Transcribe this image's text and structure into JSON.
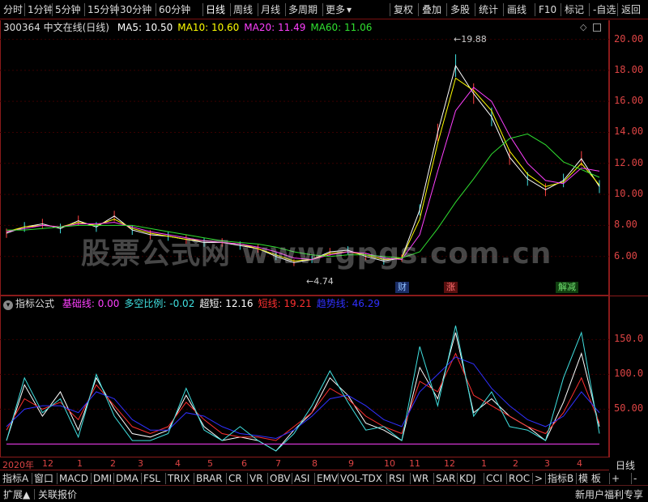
{
  "toolbar": {
    "periods": [
      "分时",
      "1分钟",
      "5分钟",
      "15分钟",
      "30分钟",
      "60分钟",
      "日线",
      "周线",
      "月线",
      "多周期",
      "更多"
    ],
    "active_period": "日线",
    "more_caret": "▾",
    "actions": [
      "复权",
      "叠加",
      "多股",
      "统计",
      "画线",
      "F10",
      "标记",
      "-自选",
      "返回"
    ]
  },
  "header": {
    "stock": "300364 中文在线(日线)",
    "ma": [
      {
        "label": "MA5: 10.50",
        "color": "#ffffff"
      },
      {
        "label": "MA10: 10.60",
        "color": "#ffff00"
      },
      {
        "label": "MA20: 11.49",
        "color": "#ff40ff"
      },
      {
        "label": "MA60: 11.06",
        "color": "#30e030"
      }
    ]
  },
  "price_axis": [
    "20.00",
    "18.00",
    "16.00",
    "14.00",
    "12.00",
    "10.00",
    "8.00",
    "6.00"
  ],
  "annotations": {
    "high": "19.88",
    "low": "4.74"
  },
  "event_tags": [
    {
      "label": "财",
      "color": "#6ab0ff"
    },
    {
      "label": "涨",
      "color": "#ff5050"
    },
    {
      "label": "解减",
      "color": "#40d040"
    }
  ],
  "watermark": "股票公式网 www.gpgs.com.cn",
  "indicator": {
    "title": "指标公式",
    "lines": [
      {
        "label": "基础线: 0.00",
        "color": "#ff40ff"
      },
      {
        "label": "多空比例: -0.02",
        "color": "#40e0e0"
      },
      {
        "label": "超短: 12.16",
        "color": "#ffffff"
      },
      {
        "label": "短线: 19.21",
        "color": "#ff3030"
      },
      {
        "label": "趋势线: 46.29",
        "color": "#3030ff"
      }
    ],
    "axis": [
      "150.0",
      "100.0",
      "50.00"
    ]
  },
  "time_axis": {
    "year": "2020年",
    "months": [
      "12",
      "1",
      "2",
      "3",
      "4",
      "5",
      "6",
      "7",
      "8",
      "9",
      "10",
      "11",
      "12",
      "1",
      "2",
      "3",
      "4"
    ],
    "period_label": "日线"
  },
  "tabs": [
    "指标A",
    "窗口",
    "MACD",
    "DMI",
    "DMA",
    "FSL",
    "TRIX",
    "BRAR",
    "CR",
    "VR",
    "OBV",
    "ASI",
    "EMV",
    "VOL-TDX",
    "RSI",
    "WR",
    "SAR",
    "KDJ",
    "CCI",
    "ROC",
    ">",
    "指标B",
    "模 板",
    "+",
    "-"
  ],
  "footer": {
    "left": [
      "扩展▲",
      "关联报价"
    ],
    "right": "新用户福利专享"
  },
  "chart_data": [
    {
      "type": "line",
      "title": "300364 中文在线(日线)",
      "ylim": [
        4,
        20.5
      ],
      "series": [
        {
          "name": "MA5",
          "values": [
            7.5,
            7.9,
            8.1,
            7.8,
            8.3,
            7.9,
            8.6,
            7.7,
            7.4,
            7.3,
            7.1,
            6.9,
            6.9,
            6.7,
            6.5,
            6.0,
            5.6,
            5.8,
            6.3,
            6.4,
            6.0,
            5.7,
            5.9,
            9.0,
            14.0,
            18.3,
            16.5,
            15.0,
            12.4,
            11.0,
            10.3,
            10.9,
            12.3,
            10.5
          ]
        },
        {
          "name": "MA10",
          "values": [
            7.6,
            7.9,
            8.0,
            7.9,
            8.2,
            8.0,
            8.4,
            7.8,
            7.5,
            7.3,
            7.1,
            7.0,
            6.9,
            6.8,
            6.5,
            6.1,
            5.7,
            5.8,
            6.2,
            6.3,
            6.1,
            5.8,
            5.9,
            8.4,
            13.3,
            17.5,
            16.7,
            15.4,
            12.8,
            11.3,
            10.5,
            10.8,
            12.0,
            10.6
          ]
        },
        {
          "name": "MA20",
          "values": [
            7.6,
            7.8,
            8.0,
            7.9,
            8.1,
            8.1,
            8.2,
            7.9,
            7.6,
            7.4,
            7.2,
            7.0,
            6.9,
            6.8,
            6.6,
            6.3,
            5.9,
            5.8,
            6.1,
            6.3,
            6.2,
            5.9,
            5.8,
            7.4,
            11.5,
            15.4,
            16.9,
            16.0,
            13.8,
            12.0,
            10.9,
            10.7,
            11.7,
            11.5
          ]
        },
        {
          "name": "MA60",
          "values": [
            7.7,
            7.7,
            7.8,
            7.9,
            8.0,
            8.0,
            8.0,
            8.0,
            7.8,
            7.6,
            7.4,
            7.2,
            7.0,
            6.9,
            6.8,
            6.6,
            6.3,
            6.1,
            6.0,
            6.1,
            6.1,
            6.0,
            5.9,
            6.3,
            7.8,
            9.5,
            11.0,
            12.6,
            13.6,
            13.9,
            13.2,
            12.1,
            11.6,
            11.1
          ]
        }
      ]
    },
    {
      "type": "line",
      "title": "指标公式",
      "ylim": [
        -10,
        190
      ],
      "series": [
        {
          "name": "超短",
          "values": [
            5,
            85,
            40,
            75,
            20,
            95,
            50,
            15,
            10,
            20,
            70,
            25,
            5,
            10,
            5,
            -10,
            20,
            45,
            95,
            70,
            30,
            20,
            5,
            110,
            65,
            160,
            45,
            65,
            40,
            25,
            5,
            60,
            130,
            25
          ]
        },
        {
          "name": "短线",
          "values": [
            20,
            65,
            50,
            60,
            35,
            85,
            55,
            25,
            15,
            25,
            60,
            35,
            15,
            10,
            10,
            5,
            25,
            45,
            80,
            65,
            40,
            25,
            15,
            90,
            75,
            130,
            70,
            55,
            40,
            25,
            15,
            45,
            95,
            30
          ]
        },
        {
          "name": "趋势线",
          "values": [
            25,
            50,
            55,
            55,
            45,
            75,
            65,
            35,
            20,
            20,
            45,
            40,
            25,
            15,
            12,
            8,
            20,
            40,
            65,
            70,
            55,
            35,
            25,
            75,
            100,
            125,
            115,
            80,
            55,
            35,
            25,
            40,
            75,
            45
          ]
        },
        {
          "name": "多空比例",
          "values": [
            5,
            95,
            45,
            65,
            10,
            100,
            40,
            5,
            5,
            15,
            80,
            20,
            5,
            25,
            5,
            -10,
            15,
            55,
            105,
            60,
            20,
            25,
            5,
            140,
            55,
            170,
            40,
            75,
            25,
            20,
            5,
            95,
            160,
            15
          ]
        },
        {
          "name": "基础线",
          "values": [
            0,
            0,
            0,
            0,
            0,
            0,
            0,
            0,
            0,
            0,
            0,
            0,
            0,
            0,
            0,
            0,
            0,
            0,
            0,
            0,
            0,
            0,
            0,
            0,
            0,
            0,
            0,
            0,
            0,
            0,
            0,
            0,
            0,
            0
          ]
        }
      ]
    }
  ]
}
